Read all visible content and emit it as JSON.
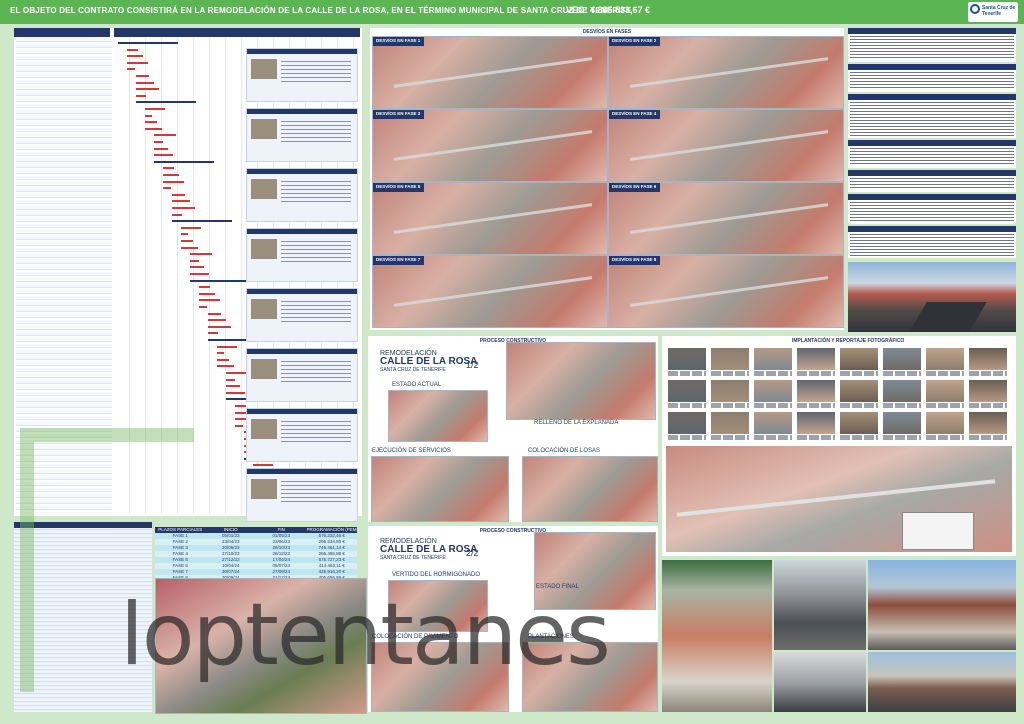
{
  "header": {
    "title": "EL OBJETO DEL CONTRATO CONSISTIRÁ EN LA REMODELACIÓN DE LA CALLE DE LA ROSA, EN EL TÉRMINO MUNICIPAL DE SANTA CRUZ DE TENERIFE",
    "vec": "VEC: 4.885.533,67 €",
    "logo_text": "Santa Cruz de Tenerife"
  },
  "sections": {
    "desvios_title": "DESVÍOS EN FASES",
    "proceso_title_1": "PROCESO CONSTRUCTIVO",
    "proceso_title_2": "PROCESO CONSTRUCTIVO",
    "implantacion_title": "IMPLANTACIÓN Y REPORTAJE FOTOGRÁFICO"
  },
  "desvios": [
    "DESVÍOS EN FASE 1",
    "DESVÍOS EN FASE 2",
    "DESVÍOS EN FASE 3",
    "DESVÍOS EN FASE 4",
    "DESVÍOS EN FASE 5",
    "DESVÍOS EN FASE 6",
    "DESVÍOS EN FASE 7",
    "DESVÍOS EN FASE 8"
  ],
  "phase_table": {
    "headers": [
      "PLAZOS PARCIALES",
      "INICIO",
      "FIN",
      "PROGRAMACIÓN (PEM)"
    ],
    "rows": [
      [
        "FASE 1",
        "05/01/23",
        "01/05/23",
        "576.232,46 €"
      ],
      [
        "FASE 2",
        "23/04/23",
        "23/06/23",
        "296.234,80 €"
      ],
      [
        "FASE 3",
        "20/06/23",
        "29/10/23",
        "746.461,14 €"
      ],
      [
        "FASE 4",
        "27/10/23",
        "28/12/23",
        "266.465,88 €"
      ],
      [
        "FASE 5",
        "27/12/23",
        "17/04/24",
        "675.727,23 €"
      ],
      [
        "FASE 6",
        "10/04/24",
        "05/07/24",
        "414.463,11 €"
      ],
      [
        "FASE 7",
        "30/07/24",
        "27/09/24",
        "425.916,20 €"
      ],
      [
        "FASE 8",
        "30/09/24",
        "31/12/24",
        "405.656,89 €"
      ]
    ]
  },
  "proceso_1": {
    "remodel": "REMODELACIÓN",
    "street": "CALLE DE LA ROSA",
    "city": "SANTA CRUZ DE TENERIFE",
    "fraction": "1/2",
    "steps": [
      "ESTADO ACTUAL",
      "RELLENO DE LA EXPLANADA",
      "EJECUCIÓN DE SERVICIOS",
      "COLOCACIÓN DE LOSAS"
    ]
  },
  "proceso_2": {
    "remodel": "REMODELACIÓN",
    "street": "CALLE DE LA ROSA",
    "city": "SANTA CRUZ DE TENERIFE",
    "fraction": "2/2",
    "steps": [
      "VERTIDO DEL HORMIGONADO",
      "ESTADO FINAL",
      "COLOCACIÓN DE PAVIMENTO",
      "PLANTACIONES"
    ]
  },
  "watermark": "loptentanes",
  "colors": {
    "green": "#5ab552",
    "navy": "#23376b",
    "bg": "#cfe8c9"
  }
}
